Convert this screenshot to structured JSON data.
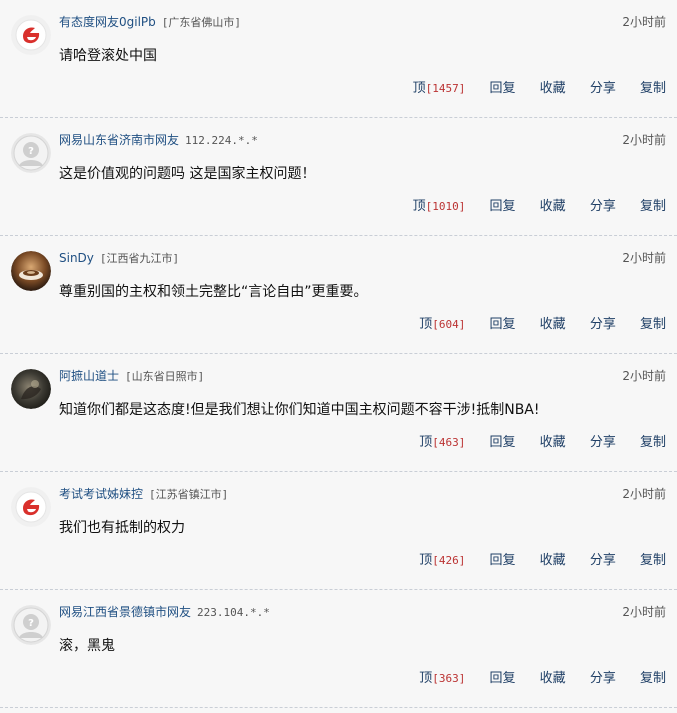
{
  "comments": [
    {
      "avatar": "netease-default-avatar",
      "username": "有态度网友0gilPb",
      "location": "[广东省佛山市]",
      "time": "2小时前",
      "content": "请哈登滚处中国",
      "vote_label": "顶",
      "vote_count": "[1457]",
      "reply_label": "回复",
      "favorite_label": "收藏",
      "share_label": "分享",
      "copy_label": "复制"
    },
    {
      "avatar": "anonymous-avatar",
      "username": "网易山东省济南市网友",
      "location": "112.224.*.*",
      "time": "2小时前",
      "content": "这是价值观的问题吗 这是国家主权问题！",
      "vote_label": "顶",
      "vote_count": "[1010]",
      "reply_label": "回复",
      "favorite_label": "收藏",
      "share_label": "分享",
      "copy_label": "复制"
    },
    {
      "avatar": "coffee-photo-avatar",
      "username": "SinDy",
      "location": "[江西省九江市]",
      "time": "2小时前",
      "content": "尊重别国的主权和领土完整比“言论自由”更重要。",
      "vote_label": "顶",
      "vote_count": "[604]",
      "reply_label": "回复",
      "favorite_label": "收藏",
      "share_label": "分享",
      "copy_label": "复制"
    },
    {
      "avatar": "dark-photo-avatar",
      "username": "阿摭山道士",
      "location": "[山东省日照市]",
      "time": "2小时前",
      "content": "知道你们都是这态度!但是我们想让你们知道中国主权问题不容干涉!抵制NBA!",
      "vote_label": "顶",
      "vote_count": "[463]",
      "reply_label": "回复",
      "favorite_label": "收藏",
      "share_label": "分享",
      "copy_label": "复制"
    },
    {
      "avatar": "netease-default-avatar",
      "username": "考试考试姊妹控",
      "location": "[江苏省镇江市]",
      "time": "2小时前",
      "content": "我们也有抵制的权力",
      "vote_label": "顶",
      "vote_count": "[426]",
      "reply_label": "回复",
      "favorite_label": "收藏",
      "share_label": "分享",
      "copy_label": "复制"
    },
    {
      "avatar": "anonymous-avatar",
      "username": "网易江西省景德镇市网友",
      "location": "223.104.*.*",
      "time": "2小时前",
      "content": "滚，黑鬼",
      "vote_label": "顶",
      "vote_count": "[363]",
      "reply_label": "回复",
      "favorite_label": "收藏",
      "share_label": "分享",
      "copy_label": "复制"
    }
  ],
  "colors": {
    "username": "#1f4f82",
    "action": "#1f3f66",
    "vote_count": "#b33333",
    "divider": "#c9ced6",
    "background": "#f7f7f7"
  }
}
